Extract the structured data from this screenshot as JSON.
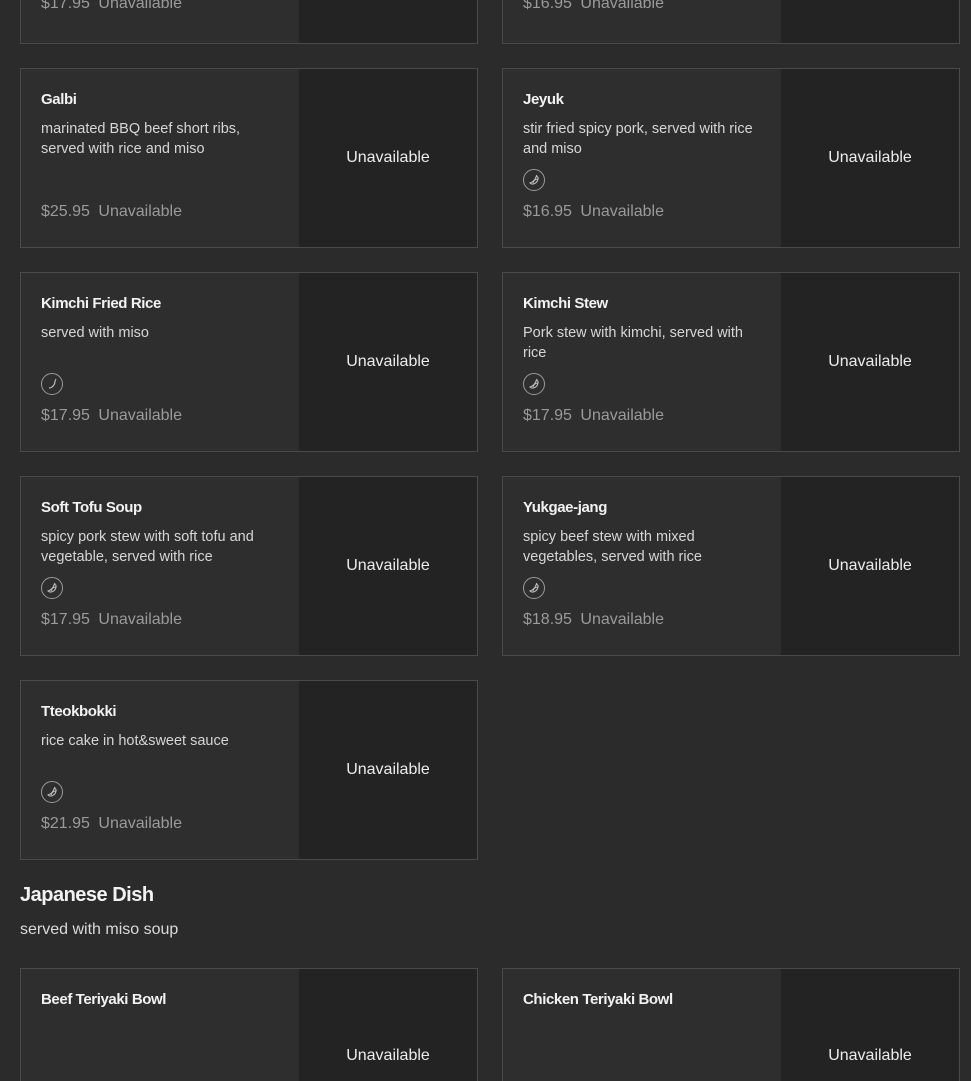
{
  "top_row": [
    {
      "price": "$17.95",
      "status": "Unavailable"
    },
    {
      "price": "$16.95",
      "status": "Unavailable"
    }
  ],
  "items": [
    {
      "name": "Galbi",
      "description": "marinated BBQ beef short ribs, served with rice and miso",
      "price": "$25.95",
      "status": "Unavailable",
      "spicy": false
    },
    {
      "name": "Jeyuk",
      "description": "stir fried spicy pork, served with rice and miso",
      "price": "$16.95",
      "status": "Unavailable",
      "spicy": true
    },
    {
      "name": "Kimchi Fried Rice",
      "description": "served with miso",
      "price": "$17.95",
      "status": "Unavailable",
      "spicy": true
    },
    {
      "name": "Kimchi Stew",
      "description": "Pork stew with kimchi, served with rice",
      "price": "$17.95",
      "status": "Unavailable",
      "spicy": true
    },
    {
      "name": "Soft Tofu Soup",
      "description": "spicy pork stew with soft tofu and vegetable, served with rice",
      "price": "$17.95",
      "status": "Unavailable",
      "spicy": true
    },
    {
      "name": "Yukgae-jang",
      "description": "spicy beef stew with mixed vegetables, served with rice",
      "price": "$18.95",
      "status": "Unavailable",
      "spicy": true
    },
    {
      "name": "Tteokbokki",
      "description": "rice cake in hot&sweet sauce",
      "price": "$21.95",
      "status": "Unavailable",
      "spicy": true
    }
  ],
  "section": {
    "title": "Japanese Dish",
    "subtitle": "served with miso soup"
  },
  "japanese_items": [
    {
      "name": "Beef Teriyaki Bowl",
      "status": "Unavailable"
    },
    {
      "name": "Chicken Teriyaki Bowl",
      "status": "Unavailable"
    }
  ],
  "icons": {
    "spicy": "pepper-icon"
  },
  "colors": {
    "background": "#2b2b2b",
    "card": "#2e2e2e",
    "thumb": "#232323",
    "border": "#4a4a4a",
    "price": "#9a9a9a"
  }
}
